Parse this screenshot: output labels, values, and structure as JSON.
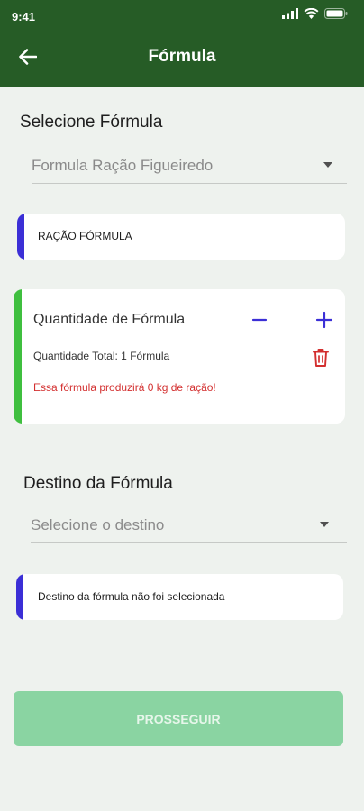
{
  "status": {
    "time": "9:41"
  },
  "header": {
    "title": "Fórmula"
  },
  "formula_section": {
    "title": "Selecione Fórmula",
    "selected": "Formula Ração Figueiredo"
  },
  "formula_type_card": {
    "label": "RAÇÃO FÓRMULA",
    "accent_color": "#3b2fd6"
  },
  "quantity_card": {
    "title": "Quantidade de Fórmula",
    "total": "Quantidade Total: 1 Fórmula",
    "warning": "Essa fórmula produzirá 0 kg de ração!",
    "accent_color": "#3fbf3f",
    "warning_color": "#d32f2f"
  },
  "destination_section": {
    "title": "Destino da Fórmula",
    "placeholder": "Selecione o destino"
  },
  "destination_card": {
    "message": "Destino da fórmula não foi selecionada",
    "accent_color": "#3b2fd6"
  },
  "actions": {
    "proceed_label": "PROSSEGUIR"
  },
  "colors": {
    "primary": "#265c26",
    "background": "#eef2ee",
    "cta_disabled": "#8ad4a2"
  }
}
